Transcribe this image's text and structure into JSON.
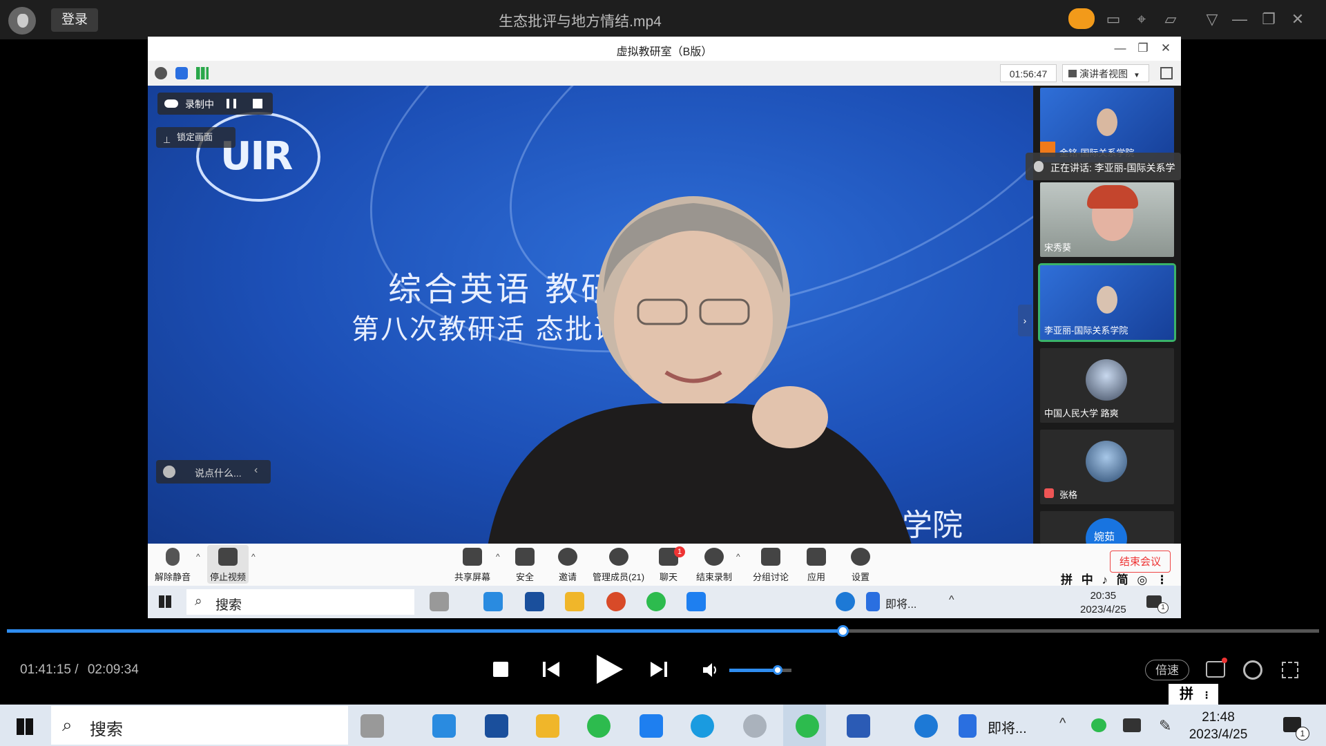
{
  "player": {
    "login_label": "登录",
    "file_title": "生态批评与地方情结.mp4",
    "accent_color": "#2f8df0"
  },
  "meeting": {
    "window_title": "虚拟教研室（B版）",
    "timer": "01:56:47",
    "view_mode": "演讲者视图",
    "recording_label": "录制中",
    "lock_screen_label": "锁定画面",
    "chat_placeholder": "说点什么...",
    "speaking_label": "正在讲话: 李亚丽-国际关系学",
    "slide": {
      "line1": "综合英语 教研室",
      "line2": "第八次教研活 态批评与地方情结",
      "bottom": "际関係学院",
      "logo_text": "UIR"
    },
    "participants": [
      {
        "name": "金铭-国际关系学院",
        "kind": "slide"
      },
      {
        "name": "宋秀葵",
        "kind": "video"
      },
      {
        "name": "李亚丽-国际关系学院",
        "kind": "slide",
        "active": true
      },
      {
        "name": "中国人民大学 路爽",
        "kind": "avatar"
      },
      {
        "name": "张格",
        "kind": "avatar"
      },
      {
        "name": "婉茹",
        "kind": "avatar-blue"
      }
    ],
    "controls": {
      "unmute": "解除静音",
      "stop_video": "停止视频",
      "share_screen": "共享屏幕",
      "security": "安全",
      "invite": "邀请",
      "manage_members": "管理成员(21)",
      "chat": "聊天",
      "chat_badge": "1",
      "end_recording": "结束录制",
      "breakout": "分组讨论",
      "apps": "应用",
      "settings": "设置",
      "end_meeting": "结束会议"
    },
    "ime": "拼 中 ♪ 简 ◎ ⋮",
    "taskbar": {
      "search": "搜索",
      "app_label": "即将...",
      "time": "20:35",
      "date": "2023/4/25",
      "notification_count": "1"
    }
  },
  "playback": {
    "current_time": "01:41:15",
    "total_time": "02:09:34",
    "progress": 0.637,
    "volume": 0.78,
    "speed_label": "倍速"
  },
  "system": {
    "ime": "拼",
    "search": "搜索",
    "app_label": "即将...",
    "time": "21:48",
    "date": "2023/4/25",
    "notification_count": "1"
  }
}
